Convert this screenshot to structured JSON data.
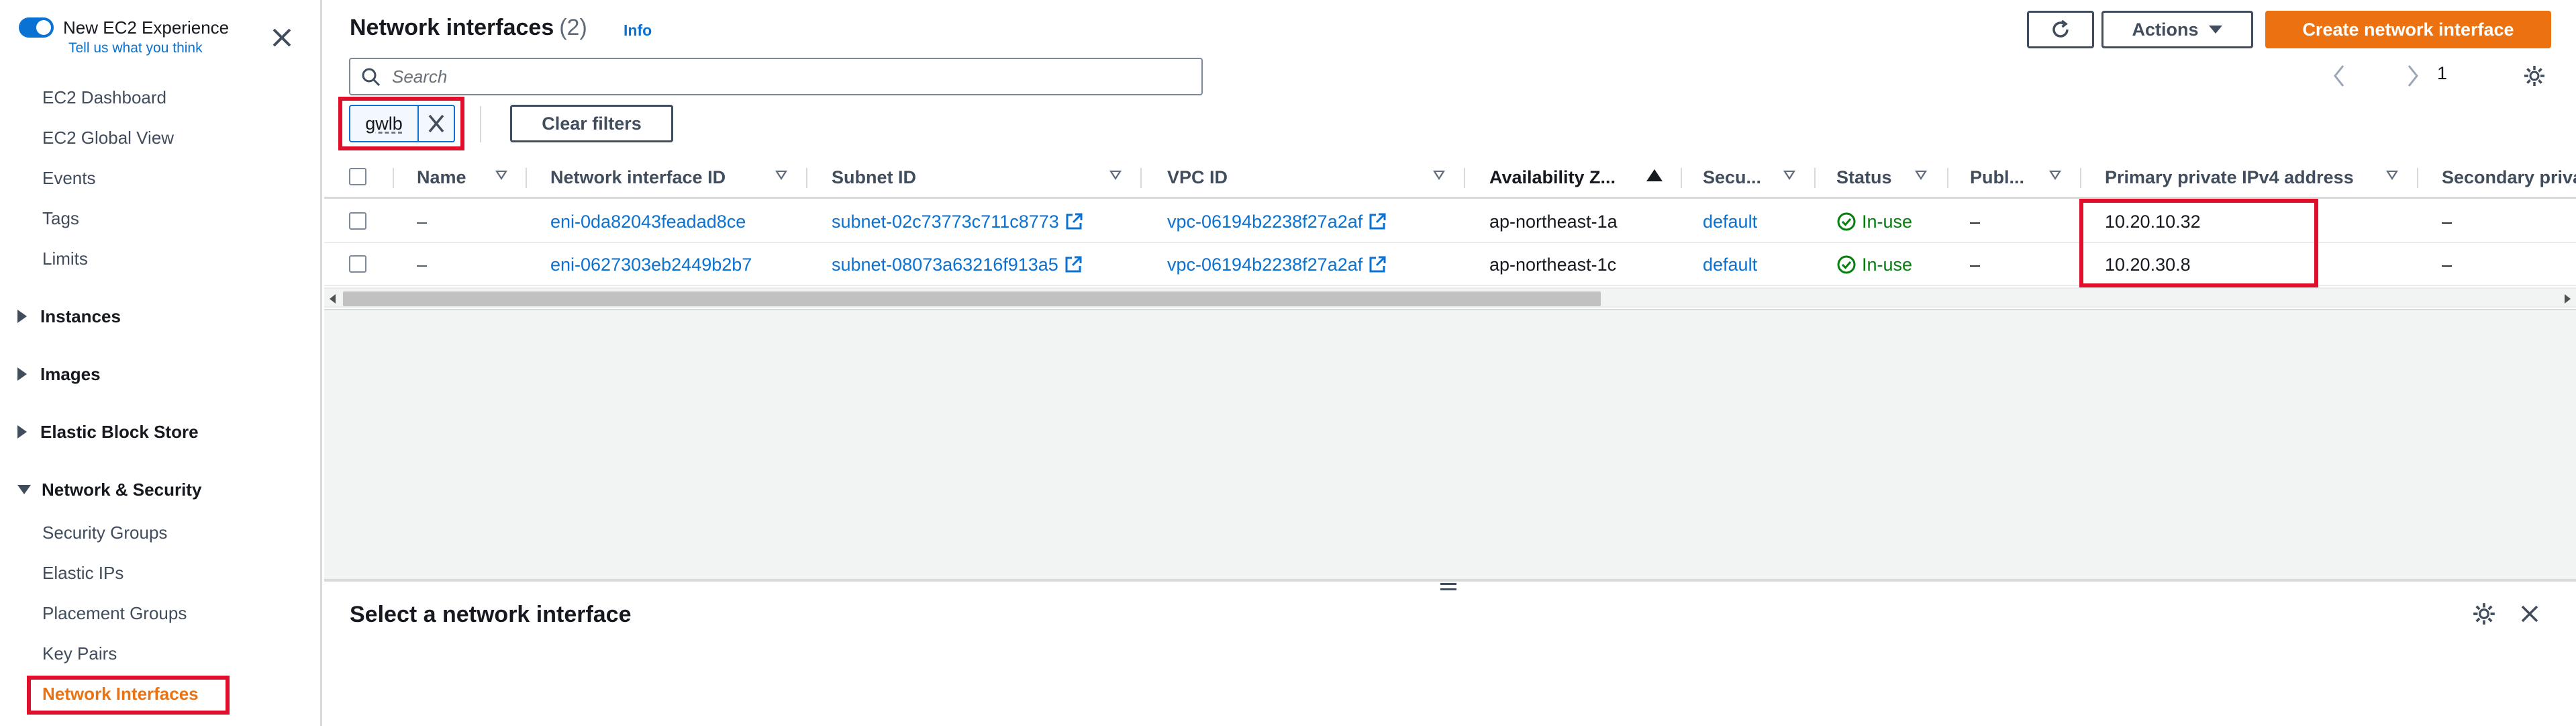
{
  "sidebar": {
    "experience_title": "New EC2 Experience",
    "experience_link": "Tell us what you think",
    "top_items": [
      "EC2 Dashboard",
      "EC2 Global View",
      "Events",
      "Tags",
      "Limits"
    ],
    "sections": {
      "instances": "Instances",
      "images": "Images",
      "ebs": "Elastic Block Store",
      "network_security": "Network & Security"
    },
    "network_items": [
      "Security Groups",
      "Elastic IPs",
      "Placement Groups",
      "Key Pairs",
      "Network Interfaces"
    ],
    "active_item": "Network Interfaces"
  },
  "header": {
    "title": "Network interfaces",
    "count": "(2)",
    "info": "Info",
    "actions_label": "Actions",
    "create_label": "Create network interface"
  },
  "search": {
    "placeholder": "Search"
  },
  "filter": {
    "token": "gwlb",
    "clear_label": "Clear filters"
  },
  "pagination": {
    "page": "1"
  },
  "table": {
    "columns": [
      "Name",
      "Network interface ID",
      "Subnet ID",
      "VPC ID",
      "Availability Z...",
      "Secu...",
      "Status",
      "Publ...",
      "Primary private IPv4 address",
      "Secondary priva"
    ],
    "rows": [
      {
        "name": "–",
        "eni": "eni-0da82043feadad8ce",
        "subnet": "subnet-02c73773c711c8773",
        "vpc": "vpc-06194b2238f27a2af",
        "az": "ap-northeast-1a",
        "security": "default",
        "status": "In-use",
        "public": "–",
        "primary_ip": "10.20.10.32",
        "secondary": "–"
      },
      {
        "name": "–",
        "eni": "eni-0627303eb2449b2b7",
        "subnet": "subnet-08073a63216f913a5",
        "vpc": "vpc-06194b2238f27a2af",
        "az": "ap-northeast-1c",
        "security": "default",
        "status": "In-use",
        "public": "–",
        "primary_ip": "10.20.30.8",
        "secondary": "–"
      }
    ]
  },
  "detail_panel": {
    "title": "Select a network interface"
  },
  "colors": {
    "accent": "#ec7211",
    "link": "#0972d3",
    "success": "#037f0c",
    "highlight": "#e0102a"
  }
}
